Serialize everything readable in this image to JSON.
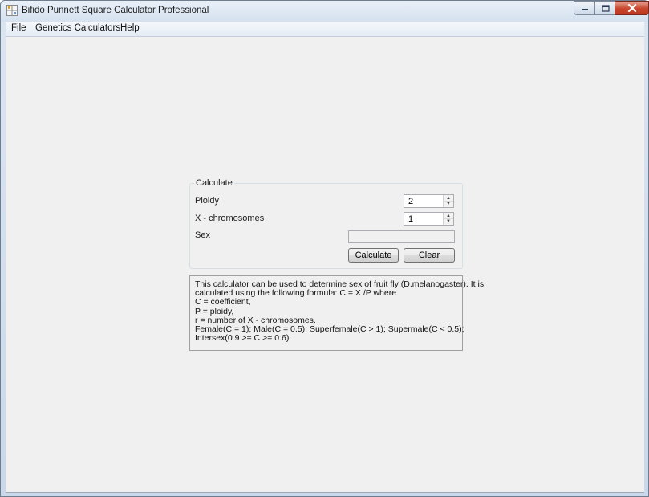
{
  "window": {
    "title": "Bifido Punnett Square Calculator Professional",
    "icons": {
      "app": "punnett-app-icon",
      "minimize": "minimize-icon",
      "maximize": "maximize-icon",
      "close": "close-icon"
    }
  },
  "menu": {
    "items": [
      "File",
      "Genetics Calculators",
      "Help"
    ]
  },
  "calculate": {
    "group_title": "Calculate",
    "ploidy": {
      "label": "Ploidy",
      "value": "2"
    },
    "x_chromosomes": {
      "label": "X - chromosomes",
      "value": "1"
    },
    "sex": {
      "label": "Sex",
      "value": ""
    },
    "buttons": {
      "calculate": "Calculate",
      "clear": "Clear"
    }
  },
  "info": {
    "lines": [
      "This calculator can be used to determine sex of fruit fly (D.melanogaster). It is",
      "calculated using the following formula: C = X /P where",
      "C = coefficient,",
      "P = ploidy,",
      "r = number of X - chromosomes.",
      "Female(C = 1); Male(C = 0.5); Superfemale(C > 1); Supermale(C < 0.5);",
      "Intersex(0.9 >= C >= 0.6)."
    ]
  },
  "colors": {
    "client_bg": "#f0f0f0",
    "close_button": "#c7452c",
    "titlebar": "#d5e1ef"
  }
}
